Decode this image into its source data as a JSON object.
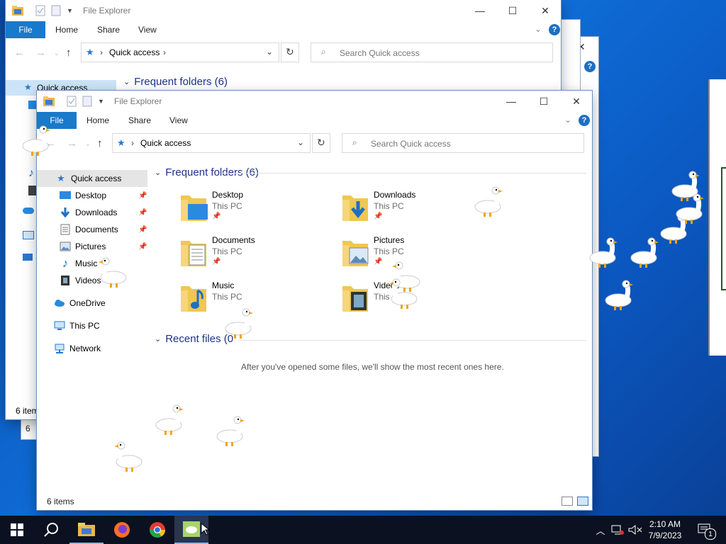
{
  "back_window": {
    "title": "File Explorer",
    "ribbon_tabs": {
      "file": "File",
      "home": "Home",
      "share": "Share",
      "view": "View"
    },
    "address": "Quick access",
    "search_placeholder": "Search Quick access",
    "nav_quick_access": "Quick access",
    "frequent_header": "Frequent folders (6)",
    "status": "6 item",
    "far_status": "6"
  },
  "front_window": {
    "title": "File Explorer",
    "ribbon_tabs": {
      "file": "File",
      "home": "Home",
      "share": "Share",
      "view": "View"
    },
    "address": "Quick access",
    "search_placeholder": "Search Quick access",
    "nav": {
      "quick_access": "Quick access",
      "desktop": "Desktop",
      "downloads": "Downloads",
      "documents": "Documents",
      "pictures": "Pictures",
      "music": "Music",
      "videos": "Videos",
      "onedrive": "OneDrive",
      "this_pc": "This PC",
      "network": "Network"
    },
    "frequent_header": "Frequent folders (6)",
    "folders": [
      {
        "name": "Desktop",
        "location": "This PC",
        "pinned": true,
        "icon": "desktop-folder-icon"
      },
      {
        "name": "Downloads",
        "location": "This PC",
        "pinned": true,
        "icon": "downloads-folder-icon"
      },
      {
        "name": "Documents",
        "location": "This PC",
        "pinned": true,
        "icon": "documents-folder-icon"
      },
      {
        "name": "Pictures",
        "location": "This PC",
        "pinned": true,
        "icon": "pictures-folder-icon"
      },
      {
        "name": "Music",
        "location": "This PC",
        "pinned": false,
        "icon": "music-folder-icon"
      },
      {
        "name": "Videos",
        "location": "This PC",
        "pinned": false,
        "icon": "videos-folder-icon"
      }
    ],
    "recent_header": "Recent files (0",
    "recent_empty": "After you've opened some files, we'll show the most recent ones here.",
    "status": "6 items"
  },
  "taskbar": {
    "time": "2:10 AM",
    "date": "7/9/2023",
    "notification_count": "1",
    "apps": [
      "start-icon",
      "search-icon",
      "file-explorer-icon",
      "firefox-icon",
      "chrome-icon",
      "desktop-goose-icon"
    ]
  },
  "colors": {
    "accent": "#1979ca",
    "section_header": "#1e3287",
    "taskbar": "#0b1120"
  }
}
